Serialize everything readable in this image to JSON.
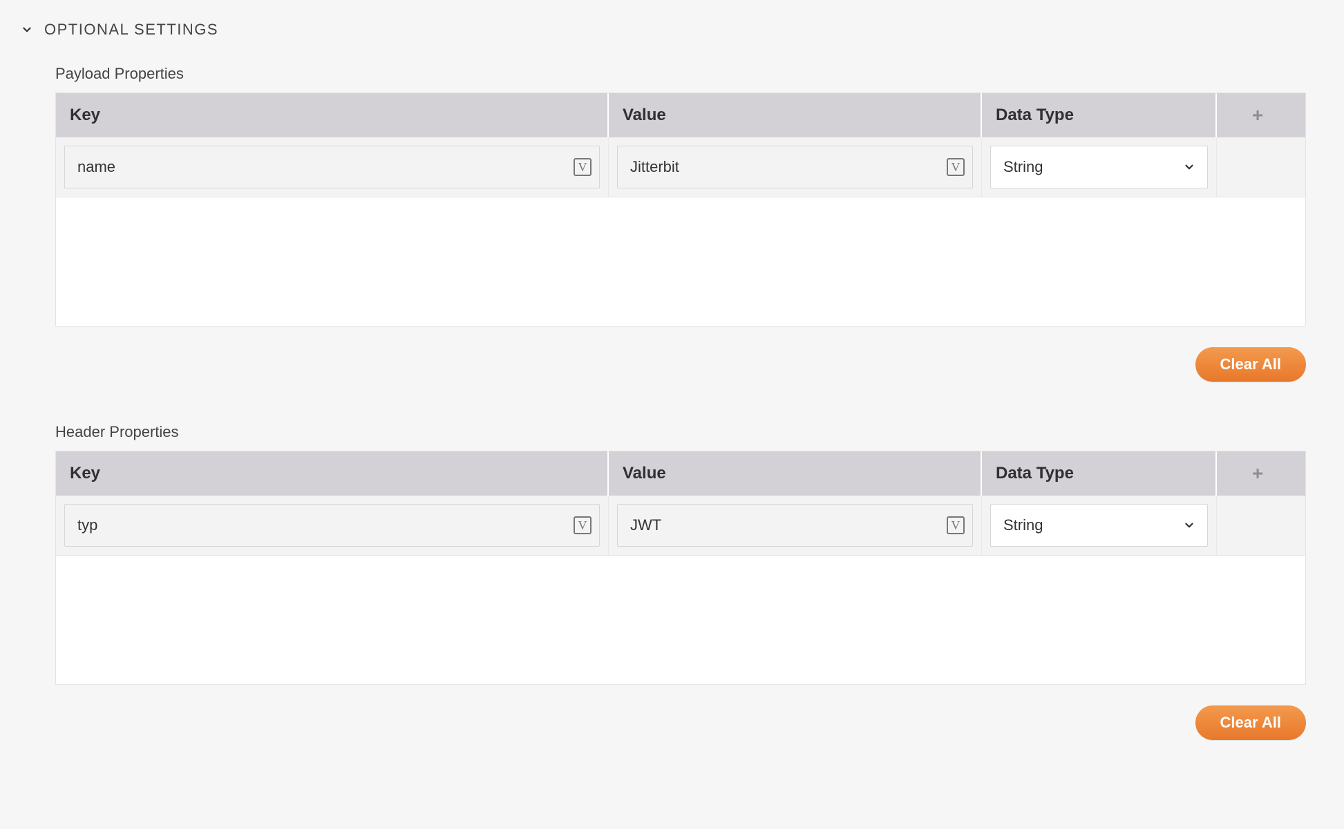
{
  "header": {
    "title": "OPTIONAL SETTINGS"
  },
  "columns": {
    "key": "Key",
    "value": "Value",
    "type": "Data Type"
  },
  "payload": {
    "title": "Payload Properties",
    "rows": [
      {
        "key": "name",
        "value": "Jitterbit",
        "type": "String"
      }
    ],
    "clear_label": "Clear All"
  },
  "header_props": {
    "title": "Header Properties",
    "rows": [
      {
        "key": "typ",
        "value": "JWT",
        "type": "String"
      }
    ],
    "clear_label": "Clear All"
  },
  "icons": {
    "variable_badge": "V"
  }
}
